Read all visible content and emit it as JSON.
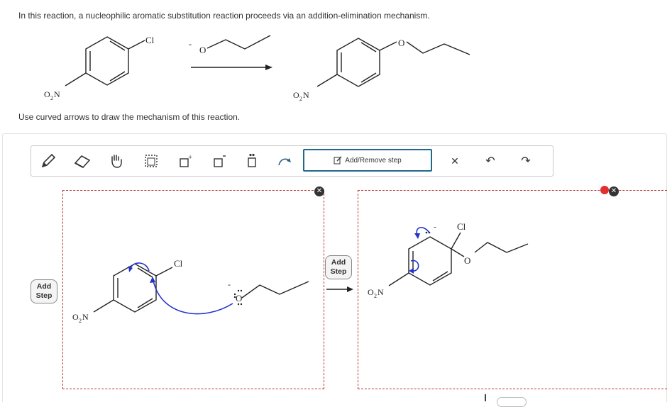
{
  "prompt": "In this reaction, a nucleophilic aromatic substitution reaction proceeds via an addition-elimination mechanism.",
  "instruction": "Use curved arrows to draw the mechanism of this reaction.",
  "chem_labels": {
    "cl": "Cl",
    "o": "O",
    "o2n_o": "O",
    "o2n_sub": "2",
    "o2n_n": "N",
    "minus": "-"
  },
  "toolbar": {
    "tools": [
      "pencil-tool",
      "eraser-tool",
      "hand-tool",
      "selection-tool",
      "positive-charge-tool",
      "negative-charge-tool",
      "lone-pair-tool",
      "curved-arrow-tool"
    ],
    "add_remove_label": "Add/Remove step",
    "clear_symbol": "✕",
    "undo_symbol": "↶",
    "redo_symbol": "↷"
  },
  "steps": {
    "add_step_label_line1": "Add",
    "add_step_label_line2": "Step",
    "delete_symbol": "✕"
  }
}
